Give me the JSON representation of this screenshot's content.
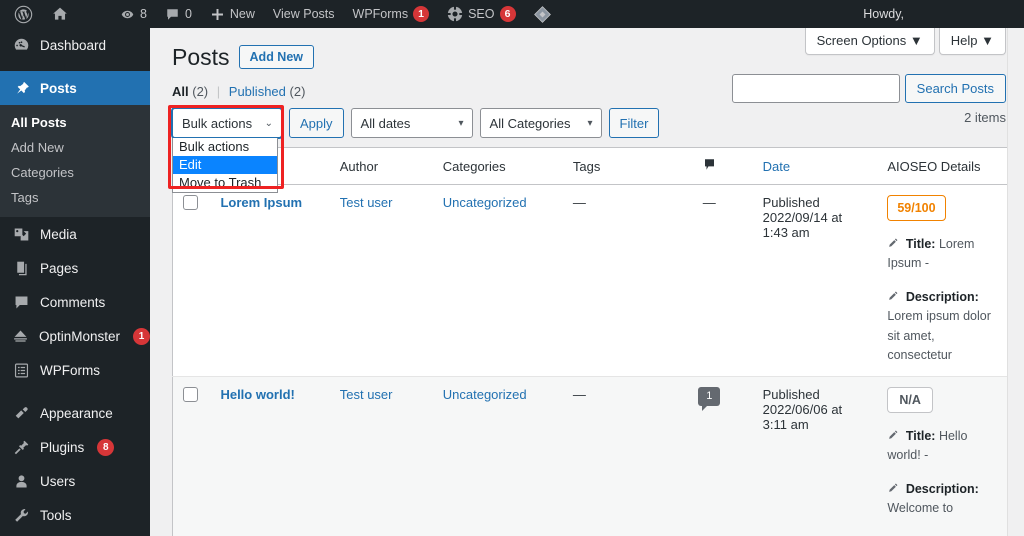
{
  "adminbar": {
    "logo_icon": "wordpress-logo-icon",
    "home_icon": "home-icon",
    "updates": {
      "icon": "updates-icon",
      "count": "8"
    },
    "comments": {
      "icon": "comment-icon",
      "count": "0"
    },
    "new": {
      "icon": "plus-icon",
      "label": "New"
    },
    "view_posts": "View Posts",
    "wpforms": {
      "label": "WPForms",
      "count": "1"
    },
    "seo": {
      "icon": "gear-icon",
      "label": "SEO",
      "count": "6"
    },
    "extra_icon": "diamond-icon",
    "howdy": "Howdy,"
  },
  "sidebar": {
    "items": [
      {
        "label": "Dashboard",
        "icon": "dashboard-icon",
        "current": false
      },
      {
        "label": "Posts",
        "icon": "pin-icon",
        "current": true
      },
      {
        "label": "Media",
        "icon": "media-icon",
        "current": false
      },
      {
        "label": "Pages",
        "icon": "pages-icon",
        "current": false
      },
      {
        "label": "Comments",
        "icon": "comment-icon",
        "current": false
      },
      {
        "label": "OptinMonster",
        "icon": "optinmonster-icon",
        "badge": "1"
      },
      {
        "label": "WPForms",
        "icon": "wpforms-icon",
        "current": false
      },
      {
        "label": "Appearance",
        "icon": "appearance-icon",
        "current": false
      },
      {
        "label": "Plugins",
        "icon": "plugins-icon",
        "badge": "8"
      },
      {
        "label": "Users",
        "icon": "users-icon",
        "current": false
      },
      {
        "label": "Tools",
        "icon": "tools-icon",
        "current": false
      }
    ],
    "posts_submenu": [
      {
        "label": "All Posts",
        "current": true
      },
      {
        "label": "Add New",
        "current": false
      },
      {
        "label": "Categories",
        "current": false
      },
      {
        "label": "Tags",
        "current": false
      }
    ]
  },
  "screen_meta": {
    "screen_options": "Screen Options",
    "help": "Help",
    "caret": "▼"
  },
  "page": {
    "title": "Posts",
    "add_new": "Add New",
    "displaying_num": "2 items"
  },
  "search": {
    "value": "",
    "placeholder": "",
    "submit": "Search Posts"
  },
  "views": {
    "all_label": "All",
    "all_count": "(2)",
    "separator": "|",
    "published_label": "Published",
    "published_count": "(2)"
  },
  "tablenav": {
    "bulk_select_value": "Bulk actions",
    "bulk_options": [
      {
        "label": "Bulk actions",
        "selected": false
      },
      {
        "label": "Edit",
        "selected": true
      },
      {
        "label": "Move to Trash",
        "selected": false
      }
    ],
    "apply": "Apply",
    "dates_value": "All dates",
    "categories_value": "All Categories",
    "filter": "Filter",
    "highlight_color": "#ee2222",
    "selection_color": "#0a84ff"
  },
  "table": {
    "columns": [
      {
        "key": "cb",
        "label": ""
      },
      {
        "key": "title",
        "label": ""
      },
      {
        "key": "author",
        "label": "Author"
      },
      {
        "key": "categories",
        "label": "Categories"
      },
      {
        "key": "tags",
        "label": "Tags"
      },
      {
        "key": "comments",
        "label": "",
        "icon": "comment-bubble-icon"
      },
      {
        "key": "date",
        "label": "Date",
        "sortable": true
      },
      {
        "key": "aioseo",
        "label": "AIOSEO Details"
      }
    ],
    "rows": [
      {
        "title": "Lorem Ipsum",
        "author": "Test user",
        "categories": "Uncategorized",
        "tags": "—",
        "comments": "—",
        "date_status": "Published",
        "date_line1": "2022/09/14 at",
        "date_line2": "1:43 am",
        "seo_score": "59/100",
        "seo_score_color": "#f18200",
        "seo_title_label": "Title:",
        "seo_title_text": "Lorem Ipsum -",
        "seo_desc_label": "Description:",
        "seo_desc_text": "Lorem ipsum dolor sit amet, consectetur"
      },
      {
        "title": "Hello world!",
        "author": "Test user",
        "categories": "Uncategorized",
        "tags": "—",
        "comments": "1",
        "date_status": "Published",
        "date_line1": "2022/06/06 at",
        "date_line2": "3:11 am",
        "seo_score": "N/A",
        "seo_score_color": "#50575e",
        "seo_title_label": "Title:",
        "seo_title_text": "Hello world! -",
        "seo_desc_label": "Description:",
        "seo_desc_text": "Welcome to"
      }
    ]
  }
}
